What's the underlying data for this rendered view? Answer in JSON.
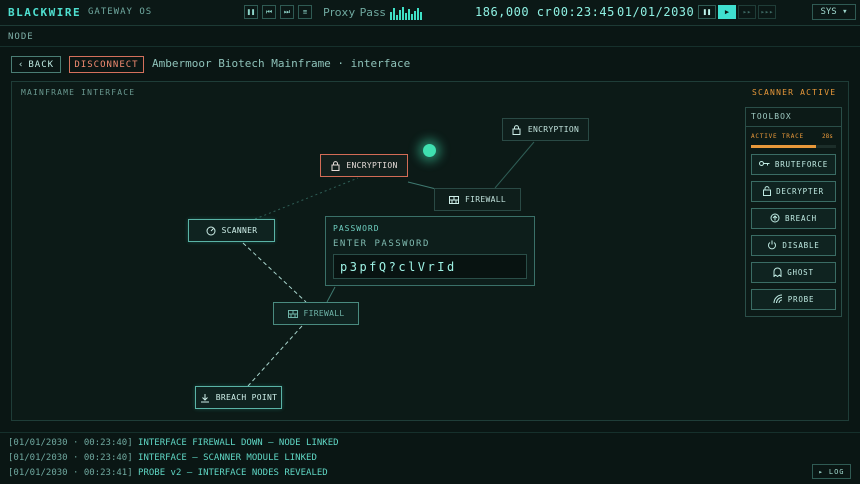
{
  "topbar": {
    "brand": "BLACKWIRE",
    "brand_sub": "GATEWAY OS",
    "media_buttons": [
      "❚❚",
      "⏮",
      "⏭",
      "≡"
    ],
    "track": "Proxy Pass",
    "credits": "186,000 cr",
    "clock": "00:23:45",
    "date": "01/01/2030",
    "speed_buttons": [
      "❚❚",
      "▶",
      "▸▸",
      "▸▸▸"
    ],
    "active_speed": "▶",
    "sys_label": "SYS ▾"
  },
  "node_header": "NODE",
  "actions": {
    "back_arrow": "‹",
    "back": "BACK",
    "disconnect": "DISCONNECT",
    "breadcrumb": "Ambermoor Biotech Mainframe · interface"
  },
  "panel": {
    "title": "MAINFRAME INTERFACE",
    "status": "SCANNER ACTIVE"
  },
  "graph_nodes": {
    "encryption_top": {
      "label": "ENCRYPTION",
      "icon": "lock-icon"
    },
    "encryption_active": {
      "label": "ENCRYPTION",
      "icon": "lock-icon"
    },
    "firewall_right": {
      "label": "FIREWALL",
      "icon": "firewall-icon"
    },
    "scanner": {
      "label": "SCANNER",
      "icon": "scanner-icon"
    },
    "firewall_center": {
      "label": "FIREWALL",
      "icon": "firewall-icon"
    },
    "breach_point": {
      "label": "BREACH POINT",
      "icon": "download-icon"
    }
  },
  "password_dialog": {
    "title": "PASSWORD",
    "prompt": "ENTER PASSWORD",
    "value": "p3pfQ?clVrId"
  },
  "toolbox": {
    "title": "TOOLBOX",
    "trace_label": "ACTIVE TRACE",
    "trace_time": "28s",
    "trace_fraction": 0.76,
    "tools": [
      {
        "label": "BRUTEFORCE",
        "icon": "key-icon"
      },
      {
        "label": "DECRYPTER",
        "icon": "unlock-icon"
      },
      {
        "label": "BREACH",
        "icon": "breach-icon"
      },
      {
        "label": "DISABLE",
        "icon": "power-icon"
      },
      {
        "label": "GHOST",
        "icon": "ghost-icon"
      },
      {
        "label": "PROBE",
        "icon": "probe-icon"
      }
    ]
  },
  "log": {
    "entries": [
      {
        "stamp": "[01/01/2030 · 00:23:40]",
        "message": "INTERFACE FIREWALL DOWN — NODE LINKED"
      },
      {
        "stamp": "[01/01/2030 · 00:23:40]",
        "message": "INTERFACE — SCANNER MODULE LINKED"
      },
      {
        "stamp": "[01/01/2030 · 00:23:41]",
        "message": "PROBE v2 — INTERFACE NODES REVEALED"
      }
    ],
    "toggle_label": "▸ LOG"
  },
  "colors": {
    "accent": "#3fe0d0",
    "warning": "#e8983a",
    "danger": "#d3705c",
    "background": "#0a1614"
  }
}
